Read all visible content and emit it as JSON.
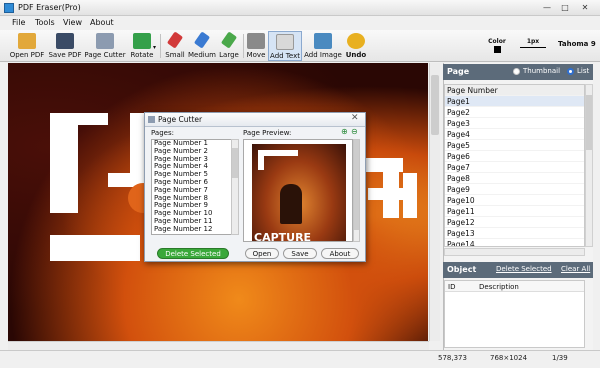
{
  "window": {
    "title": "PDF Eraser(Pro)",
    "minimize": "—",
    "maximize": "□",
    "close": "✕"
  },
  "menu": [
    "File",
    "Tools",
    "View",
    "About"
  ],
  "toolbar": {
    "tools": [
      {
        "label": "Open PDF",
        "icon": "open-pdf-icon",
        "color": "#e2a83a"
      },
      {
        "label": "Save PDF",
        "icon": "save-icon",
        "color": "#3a4b66"
      },
      {
        "label": "Page Cutter",
        "icon": "page-cutter-icon",
        "color": "#8c9bb0"
      },
      {
        "label": "Rotate",
        "icon": "rotate-icon",
        "color": "#35a04a"
      },
      {
        "label": "Small",
        "icon": "small-eraser-icon",
        "color": "#d23a3a"
      },
      {
        "label": "Medium",
        "icon": "medium-eraser-icon",
        "color": "#3a7ad2"
      },
      {
        "label": "Large",
        "icon": "large-eraser-icon",
        "color": "#4aa84a"
      },
      {
        "label": "Move",
        "icon": "move-icon",
        "color": "#8a8a8a"
      },
      {
        "label": "Add Text",
        "icon": "add-text-icon",
        "color": "#d8d8d8"
      },
      {
        "label": "Add Image",
        "icon": "add-image-icon",
        "color": "#4a8ac0"
      },
      {
        "label": "Undo",
        "icon": "undo-icon",
        "color": "#e8b020"
      }
    ],
    "color_label": "Color",
    "stroke_label": "1px",
    "font_label": "Tahoma 9"
  },
  "canvas": {
    "title_letters": "CAPTURE"
  },
  "right_panel": {
    "page_title": "Page",
    "view_thumbnail": "Thumbnail",
    "view_list": "List",
    "list_header": "Page Number",
    "pages": [
      "Page1",
      "Page2",
      "Page3",
      "Page4",
      "Page5",
      "Page6",
      "Page7",
      "Page8",
      "Page9",
      "Page10",
      "Page11",
      "Page12",
      "Page13",
      "Page14"
    ],
    "object_title": "Object",
    "delete_selected": "Delete Selected",
    "clear_all": "Clear All",
    "col_id": "ID",
    "col_description": "Description"
  },
  "dialog": {
    "title": "Page Cutter",
    "pages_label": "Pages:",
    "preview_label": "Page Preview:",
    "page_items": [
      "Page Number 1",
      "Page Number 2",
      "Page Number 3",
      "Page Number 4",
      "Page Number 5",
      "Page Number 6",
      "Page Number 7",
      "Page Number 8",
      "Page Number 9",
      "Page Number 10",
      "Page Number 11",
      "Page Number 12"
    ],
    "delete_selected": "Delete Selected",
    "open": "Open",
    "save": "Save",
    "about": "About"
  },
  "status": {
    "coords": "578,373",
    "size": "768×1024",
    "page": "1/39"
  }
}
